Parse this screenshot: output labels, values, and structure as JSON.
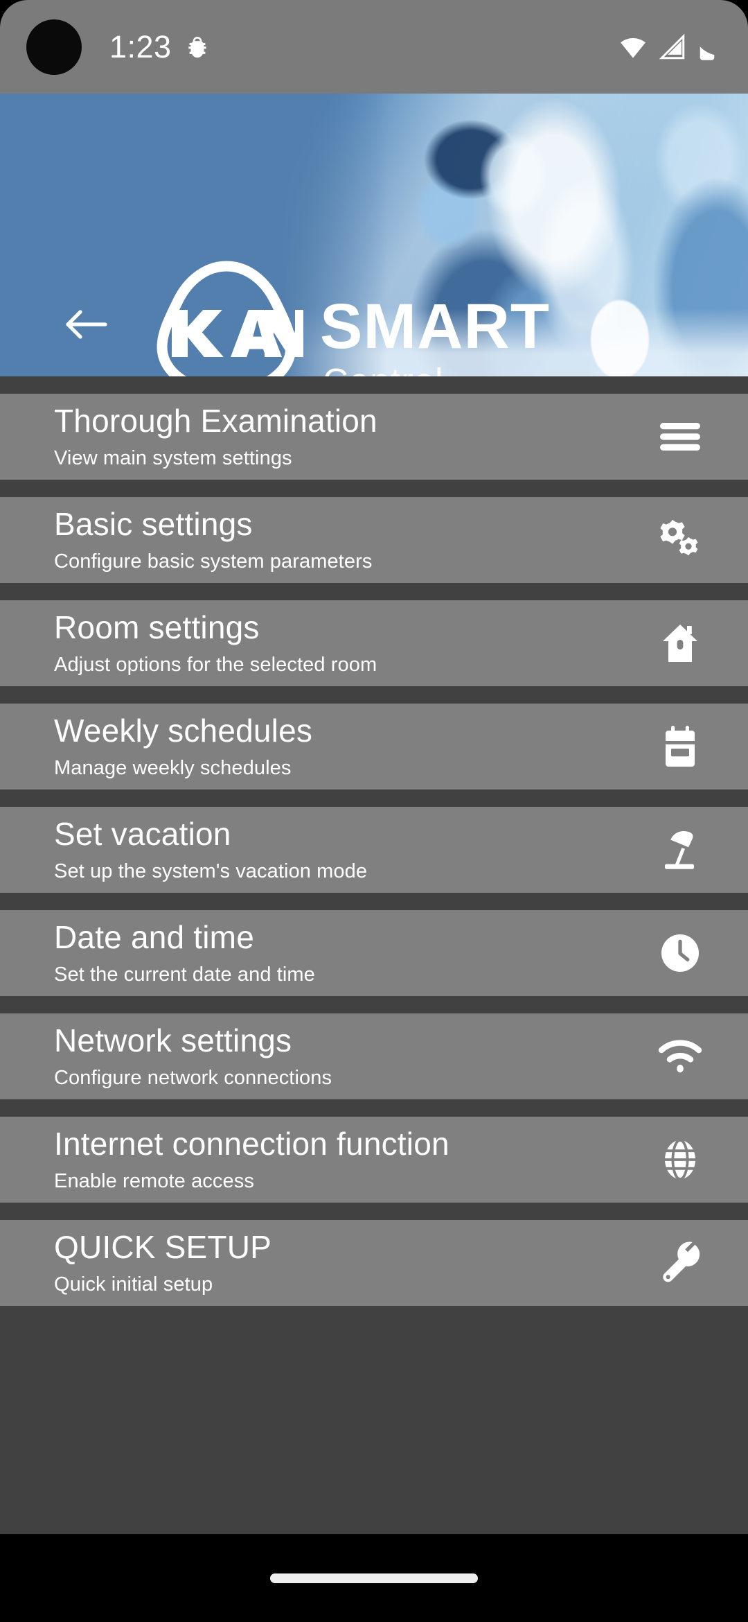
{
  "status_bar": {
    "time": "1:23",
    "bug_icon": "bug-icon",
    "wifi_icon": "wifi-icon",
    "signal_icon": "cellular-signal-icon",
    "battery_icon": "battery-full-icon",
    "background_color": "#7b7b7b"
  },
  "banner": {
    "back_icon": "back-arrow-icon",
    "logo_icon": "kan-logo-icon",
    "brand_primary": "SMART",
    "brand_secondary": "Control",
    "background_color": "#527fae"
  },
  "menu": {
    "row_background": "#808080",
    "divider_color": "#414141",
    "items": [
      {
        "title": "Thorough Examination",
        "subtitle": "View main system settings",
        "icon": "hamburger-menu-icon"
      },
      {
        "title": "Basic settings",
        "subtitle": "Configure basic system parameters",
        "icon": "gears-icon"
      },
      {
        "title": "Room settings",
        "subtitle": "Adjust options for the selected room",
        "icon": "house-icon"
      },
      {
        "title": "Weekly schedules",
        "subtitle": "Manage weekly schedules",
        "icon": "calendar-icon"
      },
      {
        "title": "Set vacation",
        "subtitle": "Set up the system's vacation mode",
        "icon": "beach-umbrella-icon"
      },
      {
        "title": "Date and time",
        "subtitle": "Set the current date and time",
        "icon": "clock-icon"
      },
      {
        "title": "Network settings",
        "subtitle": "Configure network connections",
        "icon": "wifi-icon"
      },
      {
        "title": "Internet connection function",
        "subtitle": "Enable remote access",
        "icon": "globe-icon"
      },
      {
        "title": "QUICK SETUP",
        "subtitle": "Quick initial setup",
        "icon": "wrench-icon"
      }
    ]
  },
  "nav_bar": {
    "gesture_pill": "home-gesture-pill"
  }
}
